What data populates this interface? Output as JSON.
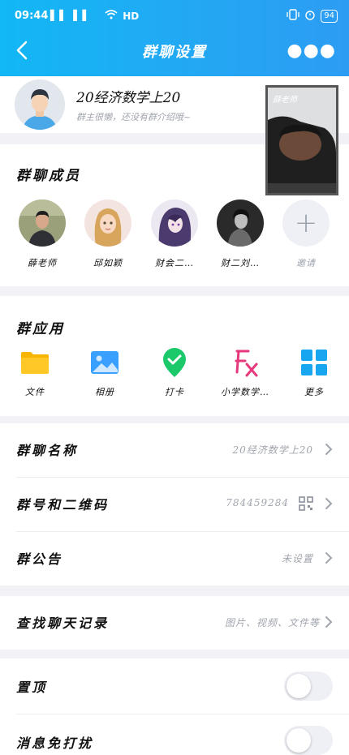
{
  "status": {
    "time": "09:44",
    "left_icons": "▌▌ ▌▌",
    "network": "HD",
    "battery": "94"
  },
  "nav": {
    "title": "群聊设置"
  },
  "group": {
    "name": "20经济数学上20",
    "desc": "群主很懒，还没有群介绍哦~"
  },
  "video": {
    "label": "薛老师"
  },
  "members": {
    "title": "群聊成员",
    "items": [
      {
        "name": "薛老师"
      },
      {
        "name": "邱如颖"
      },
      {
        "name": "财会二…"
      },
      {
        "name": "财二刘…"
      }
    ],
    "invite_label": "邀请"
  },
  "apps": {
    "title": "群应用",
    "items": [
      {
        "name": "文件",
        "icon": "folder-icon"
      },
      {
        "name": "相册",
        "icon": "photo-album-icon"
      },
      {
        "name": "打卡",
        "icon": "check-in-icon"
      },
      {
        "name": "小学数学…",
        "icon": "fx-icon"
      },
      {
        "name": "更多",
        "icon": "grid-icon"
      }
    ]
  },
  "rows": {
    "group_name": {
      "label": "群聊名称",
      "value": "20经济数学上20"
    },
    "group_number": {
      "label": "群号和二维码",
      "value": "784459284"
    },
    "announcement": {
      "label": "群公告",
      "value": "未设置"
    },
    "search_history": {
      "label": "查找聊天记录",
      "value": "图片、视频、文件等"
    },
    "pin_top": {
      "label": "置顶",
      "on": false
    },
    "do_not_disturb": {
      "label": "消息免打扰",
      "on": false
    }
  },
  "colors": {
    "accent": "#12b7f5",
    "folder": "#f7b500",
    "album": "#3aa0ff",
    "check": "#1bc96b",
    "fx": "#e6397d",
    "more": "#18a6f0"
  }
}
